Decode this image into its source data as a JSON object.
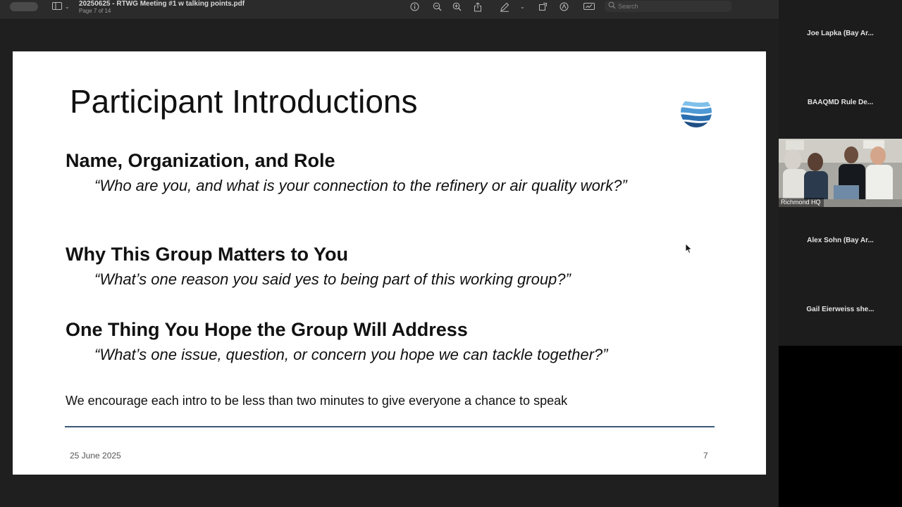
{
  "viewer": {
    "doc_title": "20250625 - RTWG Meeting #1 w talking points.pdf",
    "page_indicator": "Page 7 of 14",
    "search": {
      "placeholder": "Search"
    },
    "icons": [
      "sidebar-icon",
      "info-icon",
      "zoom-out-icon",
      "zoom-in-icon",
      "share-icon",
      "markup-pen-icon",
      "rotate-icon",
      "annotate-icon",
      "toolbox-icon",
      "search-icon"
    ]
  },
  "slide": {
    "title": "Participant Introductions",
    "sections": [
      {
        "heading": "Name, Organization, and Role",
        "question": "“Who are you, and what is your connection to the refinery or air quality work?”"
      },
      {
        "heading": "Why This Group Matters to You",
        "question": "“What’s one reason you said yes to being part of this working group?”"
      },
      {
        "heading": "One Thing You Hope the Group Will Address",
        "question": "“What’s one issue, question, or concern you hope we can tackle together?”"
      }
    ],
    "note": "We encourage each intro to be less than two minutes to give everyone a chance to speak",
    "footer_date": "25 June 2025",
    "footer_page": "7",
    "logo_colors": [
      "#2a6fb0",
      "#4e9ad6",
      "#7fc0ea",
      "#1e4f86"
    ]
  },
  "participants": {
    "tiles": [
      {
        "name": "Joe Lapka (Bay Ar..."
      },
      {
        "name": "BAAQMD Rule De..."
      },
      {
        "name": "Alex Sohn (Bay Ar..."
      },
      {
        "name": "Gail Eierweiss she..."
      }
    ],
    "video_label": "Richmond HQ"
  }
}
